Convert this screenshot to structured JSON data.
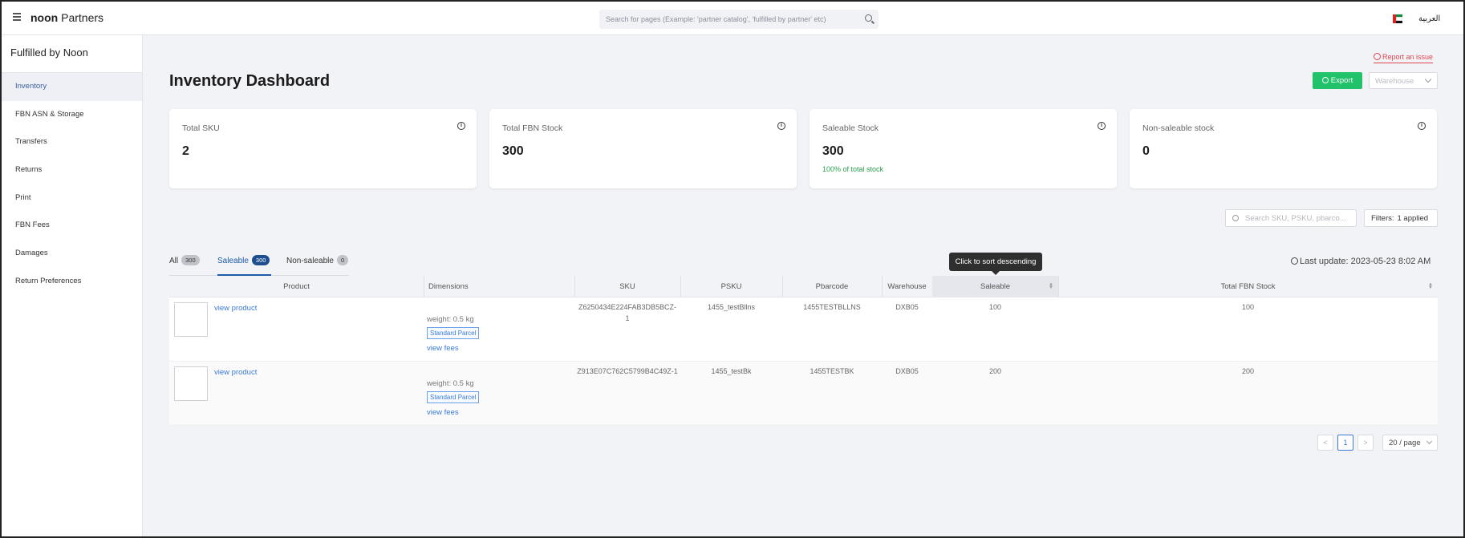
{
  "header": {
    "brand_bold": "noon",
    "brand_rest": "Partners",
    "search_placeholder": "Search for pages (Example: 'partner catalog', 'fulfilled by partner' etc)",
    "language": "العربية"
  },
  "sidebar": {
    "title": "Fulfilled by Noon",
    "items": [
      {
        "label": "Inventory"
      },
      {
        "label": "FBN ASN & Storage"
      },
      {
        "label": "Transfers"
      },
      {
        "label": "Returns"
      },
      {
        "label": "Print"
      },
      {
        "label": "FBN Fees"
      },
      {
        "label": "Damages"
      },
      {
        "label": "Return Preferences"
      }
    ]
  },
  "main": {
    "title": "Inventory Dashboard",
    "report_issue": "Report an issue",
    "export_label": "Export",
    "warehouse_placeholder": "Warehouse",
    "cards": [
      {
        "label": "Total SKU",
        "value": "2",
        "sub": ""
      },
      {
        "label": "Total FBN Stock",
        "value": "300",
        "sub": ""
      },
      {
        "label": "Saleable Stock",
        "value": "300",
        "sub": "100% of total stock"
      },
      {
        "label": "Non-saleable stock",
        "value": "0",
        "sub": ""
      }
    ],
    "sku_search_placeholder": "Search SKU, PSKU, pbarco...",
    "filters_label": "Filters:",
    "filters_value": "1 applied",
    "tabs": [
      {
        "label": "All",
        "count": "300"
      },
      {
        "label": "Saleable",
        "count": "300"
      },
      {
        "label": "Non-saleable",
        "count": "0"
      }
    ],
    "last_update": "Last update: 2023-05-23 8:02 AM",
    "tooltip": "Click to sort descending",
    "table": {
      "columns": [
        "Product",
        "Dimensions",
        "SKU",
        "PSKU",
        "Pbarcode",
        "Warehouse",
        "Saleable",
        "Total FBN Stock"
      ],
      "rows": [
        {
          "product_link": "view product",
          "weight": "weight: 0.5 kg",
          "badge": "Standard Parcel",
          "fees_link": "view fees",
          "sku_line1": "Z6250434E224FAB3DB5BCZ-",
          "sku_line2": "1",
          "psku": "1455_testBllns",
          "pbarcode": "1455TESTBLLNS",
          "warehouse": "DXB05",
          "saleable": "100",
          "total": "100"
        },
        {
          "product_link": "view product",
          "weight": "weight: 0.5 kg",
          "badge": "Standard Parcel",
          "fees_link": "view fees",
          "sku_line1": "Z913E07C762C5799B4C49Z-1",
          "sku_line2": "",
          "psku": "1455_testBk",
          "pbarcode": "1455TESTBK",
          "warehouse": "DXB05",
          "saleable": "200",
          "total": "200"
        }
      ]
    },
    "pagination": {
      "prev": "<",
      "current": "1",
      "next": ">",
      "page_size": "20 / page"
    }
  }
}
